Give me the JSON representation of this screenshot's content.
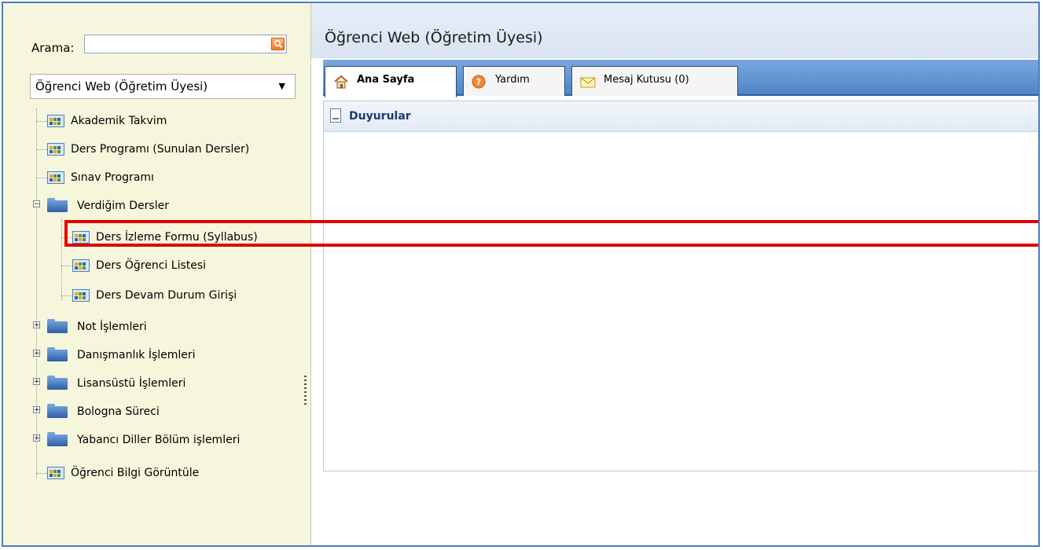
{
  "search": {
    "label": "Arama:",
    "value": ""
  },
  "module_select": {
    "selected": "Öğrenci Web (Öğretim Üyesi)"
  },
  "tree": {
    "items": [
      {
        "label": "Akademik Takvim"
      },
      {
        "label": "Ders Programı (Sunulan Dersler)"
      },
      {
        "label": "Sınav Programı"
      },
      {
        "label": "Verdiğim Dersler"
      },
      {
        "label": "Ders İzleme Formu (Syllabus)"
      },
      {
        "label": "Ders Öğrenci Listesi"
      },
      {
        "label": "Ders Devam Durum Girişi"
      },
      {
        "label": "Not İşlemleri"
      },
      {
        "label": "Danışmanlık İşlemleri"
      },
      {
        "label": "Lisansüstü İşlemleri"
      },
      {
        "label": "Bologna Süreci"
      },
      {
        "label": "Yabancı Diller Bölüm işlemleri"
      },
      {
        "label": "Öğrenci Bilgi Görüntüle"
      }
    ]
  },
  "header": {
    "title": "Öğrenci Web (Öğretim Üyesi)"
  },
  "tabs": [
    {
      "label": "Ana Sayfa",
      "icon": "home-icon"
    },
    {
      "label": "Yardım",
      "icon": "help-icon"
    },
    {
      "label": "Mesaj Kutusu (0)",
      "icon": "mail-icon"
    }
  ],
  "panel": {
    "title": "Duyurular"
  },
  "colors": {
    "accent": "#4f86c9",
    "highlight": "#e00000",
    "sidebar_bg": "#f6f6dc"
  }
}
